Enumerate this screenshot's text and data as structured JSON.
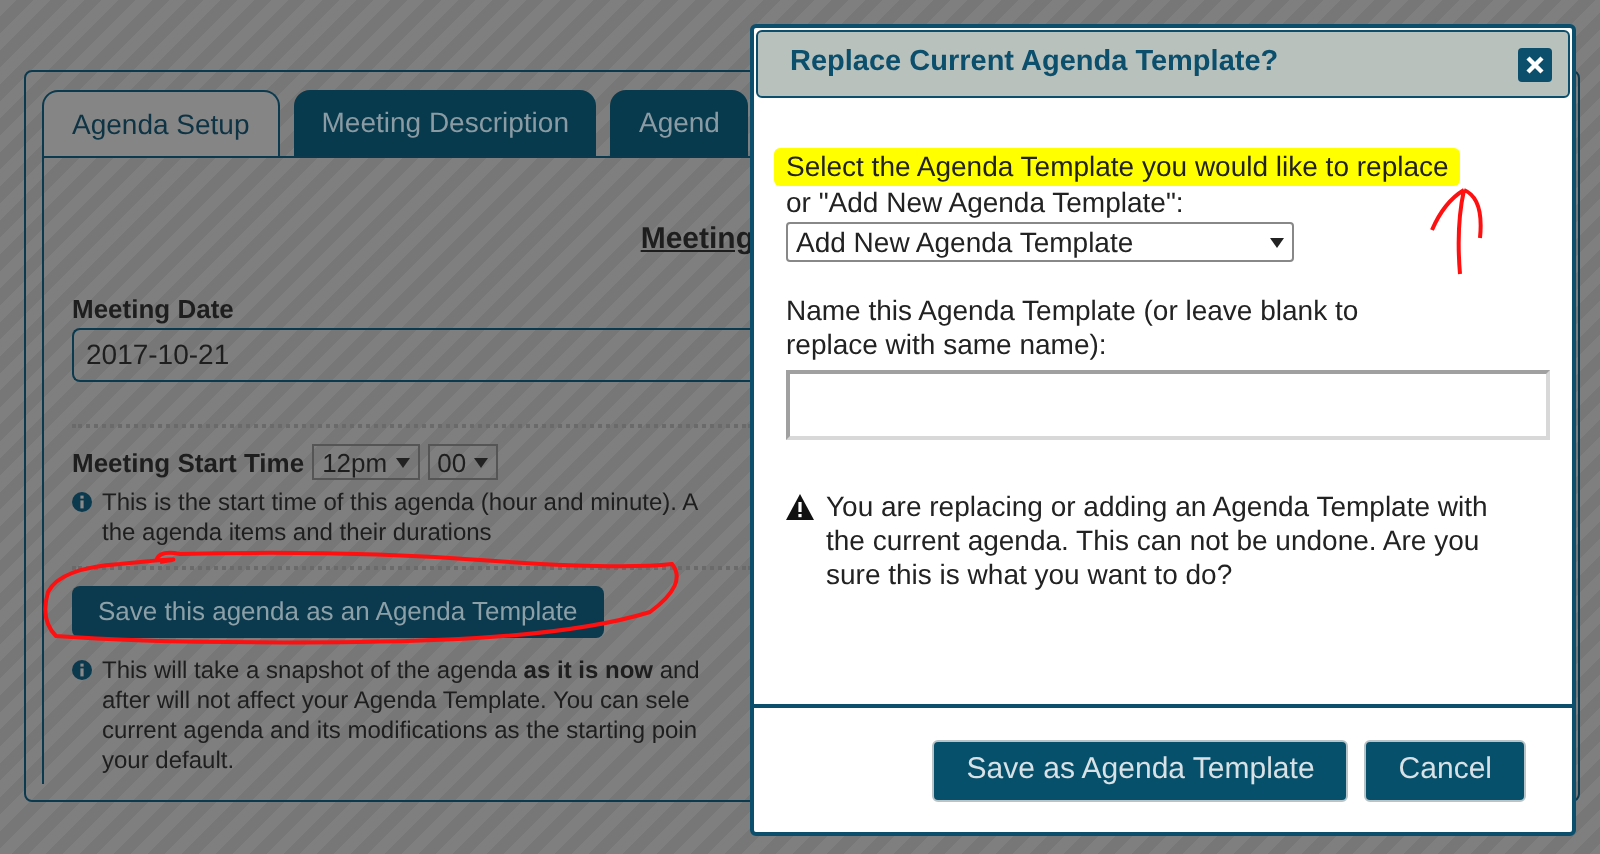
{
  "background_page": {
    "tabs": [
      {
        "label": "Agenda Setup",
        "selected": true
      },
      {
        "label": "Meeting Description",
        "selected": false
      },
      {
        "label": "Agend",
        "selected": false
      }
    ],
    "heading": "Meeting",
    "meeting_date": {
      "label": "Meeting Date",
      "value": "2017-10-21"
    },
    "start_time": {
      "label": "Meeting Start Time",
      "hour": "12pm",
      "minute": "00",
      "help_lines": [
        "This is the start time of this agenda (hour and minute). A",
        "the agenda items and their durations"
      ]
    },
    "save_button": "Save this agenda as an Agenda Template",
    "save_help_lines": [
      "This will take a snapshot of the agenda **as it is now** and",
      "after will not affect your Agenda Template. You can sele",
      "current agenda and its modifications as the starting poin",
      "your default."
    ]
  },
  "dialog": {
    "title": "Replace Current Agenda Template?",
    "select_label_lines": [
      "Select the Agenda Template you would like to replace",
      "or \"Add New Agenda Template\":"
    ],
    "select_value": "Add New Agenda Template",
    "name_label": "Name this Agenda Template (or leave blank to replace with same name):",
    "warning": "You are replacing or adding an Agenda Template with the current agenda. This can not be undone. Are you sure this is what you want to do?",
    "buttons": [
      {
        "label": "Save as Agenda Template"
      },
      {
        "label": "Cancel"
      }
    ]
  },
  "annotations": {
    "prompt_highlighted": true,
    "save_button_circled": true,
    "arrow_to_prompt": true
  }
}
